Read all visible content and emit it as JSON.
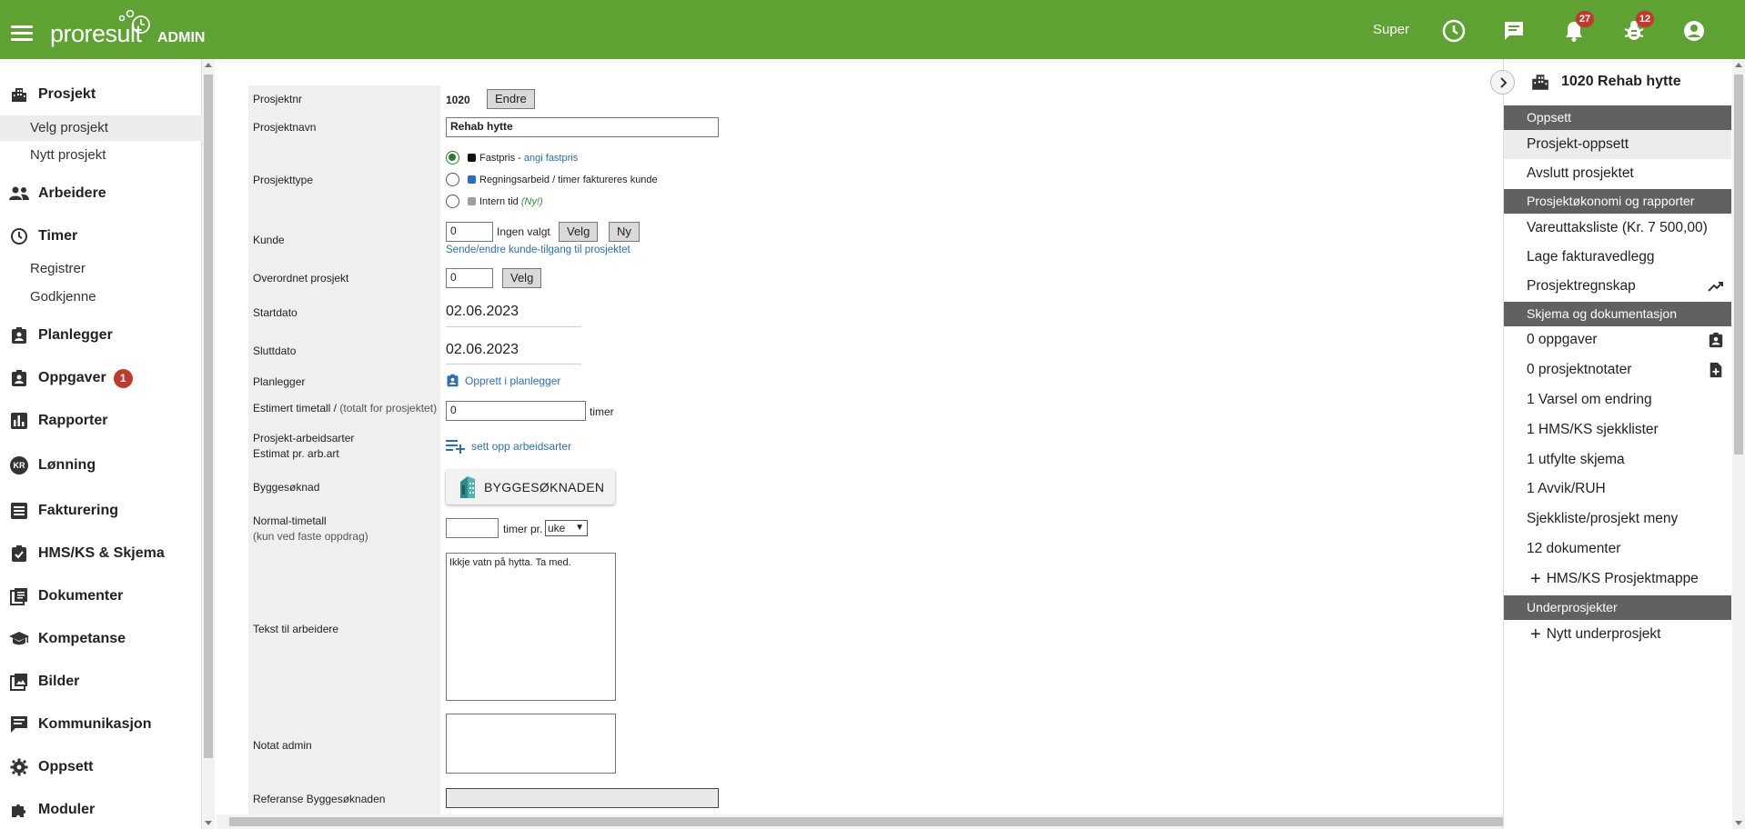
{
  "header": {
    "logo": "proresult",
    "logo_sub": "ADMIN",
    "user": "Super",
    "notifications_count": "27",
    "alerts_count": "12"
  },
  "sidebar": {
    "items": [
      {
        "label": "Prosjekt",
        "icon": "building-icon"
      },
      {
        "label": "Arbeidere",
        "icon": "people-icon"
      },
      {
        "label": "Timer",
        "icon": "clock-icon"
      },
      {
        "label": "Planlegger",
        "icon": "badge-icon"
      },
      {
        "label": "Oppgaver",
        "icon": "clipboard-icon",
        "badge": "1"
      },
      {
        "label": "Rapporter",
        "icon": "bar-chart-icon"
      },
      {
        "label": "Lønning",
        "icon": "kr-icon",
        "avatar_text": "KR"
      },
      {
        "label": "Fakturering",
        "icon": "list-icon"
      },
      {
        "label": "HMS/KS & Skjema",
        "icon": "checklist-icon"
      },
      {
        "label": "Dokumenter",
        "icon": "documents-icon"
      },
      {
        "label": "Kompetanse",
        "icon": "graduation-icon"
      },
      {
        "label": "Bilder",
        "icon": "images-icon"
      },
      {
        "label": "Kommunikasjon",
        "icon": "chat-icon"
      },
      {
        "label": "Oppsett",
        "icon": "gear-icon"
      },
      {
        "label": "Moduler",
        "icon": "puzzle-icon"
      }
    ],
    "prosjekt_sub": [
      "Velg prosjekt",
      "Nytt prosjekt"
    ],
    "timer_sub": [
      "Registrer",
      "Godkjenne"
    ]
  },
  "form": {
    "prosjektnr_label": "Prosjektnr",
    "prosjektnr_value": "1020",
    "endre_btn": "Endre",
    "prosjektnavn_label": "Prosjektnavn",
    "prosjektnavn_value": "Rehab hytte",
    "prosjekttype_label": "Prosjekttype",
    "type_fastpris": "Fastpris - ",
    "type_fastpris_link": "angi fastpris",
    "type_regning": "Regningsarbeid / timer faktureres kunde",
    "type_intern": "Intern tid ",
    "type_intern_new": "(Ny!)",
    "kunde_label": "Kunde",
    "kunde_value": "0",
    "kunde_status": "Ingen valgt",
    "velg_btn": "Velg",
    "ny_btn": "Ny",
    "kunde_link": "Sende/endre kunde-tilgang til prosjektet",
    "overordnet_label": "Overordnet prosjekt",
    "overordnet_value": "0",
    "startdato_label": "Startdato",
    "startdato_value": "02.06.2023",
    "sluttdato_label": "Sluttdato",
    "sluttdato_value": "02.06.2023",
    "planlegger_label": "Planlegger",
    "planlegger_link": "Opprett i planlegger",
    "estimert_label": "Estimert timetall / ",
    "estimert_label_muted": "(totalt for prosjektet)",
    "estimert_value": "0",
    "timer_unit": "timer",
    "arbeidsarter_label1": "Prosjekt-arbeidsarter",
    "arbeidsarter_label2": "Estimat pr. arb.art",
    "arbeidsarter_link": "sett opp arbeidsarter",
    "byggesoknad_label": "Byggesøknad",
    "byggesoknad_btn": "BYGGESØKNADEN",
    "normal_label": "Normal-timetall",
    "normal_label_muted": "(kun ved faste oppdrag)",
    "normal_value": "",
    "timer_pr": "timer pr.",
    "period_select": "uke",
    "tekst_label": "Tekst til arbeidere",
    "tekst_value": "Ikkje vatn på hytta. Ta med.",
    "notat_label": "Notat admin",
    "notat_value": "",
    "referanse_label": "Referanse Byggesøknaden",
    "referanse_value": ""
  },
  "right_panel": {
    "title": "1020 Rehab hytte",
    "sections": [
      {
        "header": "Oppsett",
        "items": [
          "Prosjekt-oppsett",
          "Avslutt prosjektet"
        ]
      },
      {
        "header": "Prosjektøkonomi og rapporter",
        "items": [
          "Vareuttaksliste (Kr. 7 500,00)",
          "Lage fakturavedlegg",
          "Prosjektregnskap"
        ]
      },
      {
        "header": "Skjema og dokumentasjon",
        "items": [
          "0 oppgaver",
          "0 prosjektnotater",
          "1 Varsel om endring",
          "1 HMS/KS sjekklister",
          "1 utfylte skjema",
          "1 Avvik/RUH",
          "Sjekkliste/prosjekt meny",
          "12 dokumenter",
          "HMS/KS Prosjektmappe"
        ]
      },
      {
        "header": "Underprosjekter",
        "items": [
          "Nytt underprosjekt"
        ]
      }
    ]
  },
  "colors": {
    "brand_green": "#5ea234",
    "badge_red": "#c0392b",
    "link_blue": "#2a6fbf",
    "section_header": "#616161"
  }
}
